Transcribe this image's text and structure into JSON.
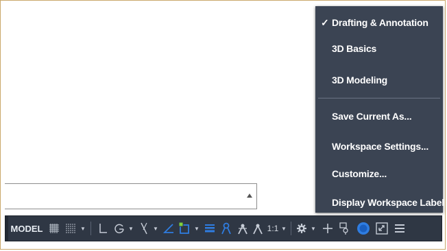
{
  "workspace_menu": {
    "items": [
      {
        "label": "Drafting & Annotation",
        "checked": true,
        "check_mark": "✓"
      },
      {
        "label": "3D Basics",
        "checked": false
      },
      {
        "label": "3D Modeling",
        "checked": false
      },
      {
        "label": "Save Current As...",
        "checked": false
      },
      {
        "label": "Workspace Settings...",
        "checked": false
      },
      {
        "label": "Customize...",
        "checked": false
      },
      {
        "label": "Display Workspace Label",
        "checked": false
      }
    ]
  },
  "status_bar": {
    "model_label": "MODEL",
    "annotation_scale": "1:1",
    "dropdown_glyph": "▼",
    "icons": [
      "grid-icon",
      "snap-mode-icon",
      "ortho-icon",
      "polar-tracking-icon",
      "isometric-drafting-icon",
      "object-snap-tracking-icon",
      "object-snap-icon",
      "lineweight-icon",
      "annotation-visibility-icon",
      "auto-scale-icon",
      "annotation-scale-icon",
      "workspace-switching-gear-icon",
      "plus-icon",
      "isolate-objects-icon",
      "hardware-acceleration-icon",
      "clean-screen-icon",
      "customization-menu-icon"
    ]
  },
  "colors": {
    "menu_background": "#3b4453",
    "status_bar_background": "#2f3744",
    "accent_blue": "#2f7de1",
    "frame_border": "#c9a86a"
  }
}
